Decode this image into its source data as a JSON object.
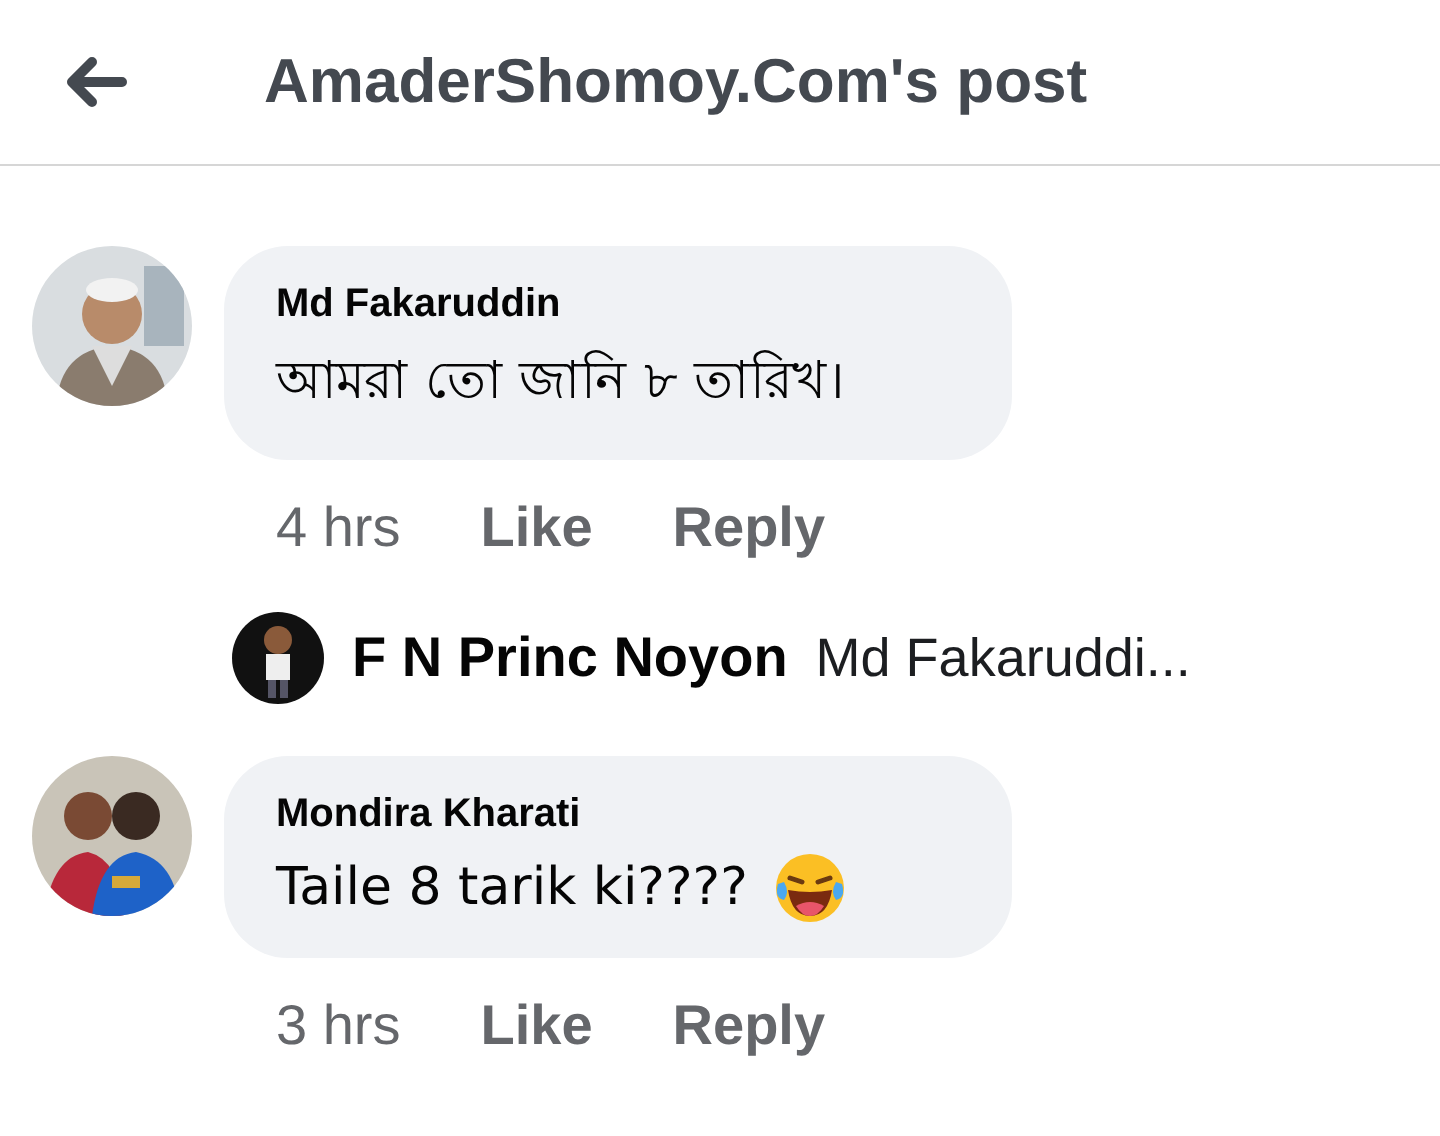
{
  "header": {
    "title": "AmaderShomoy.Com's post"
  },
  "comments": [
    {
      "author": "Md Fakaruddin",
      "text": "আমরা তো জানি ৮ তারিখ।",
      "trailing_icon": false,
      "time": "4 hrs",
      "actions": [
        "Like",
        "Reply"
      ],
      "reply_preview": {
        "author": "F N Princ Noyon",
        "text": "Md Fakaruddi..."
      }
    },
    {
      "author": "Mondira Kharati",
      "text": "Taile 8 tarik ki????",
      "trailing_icon": true,
      "time": "3 hrs",
      "actions": [
        "Like",
        "Reply"
      ]
    }
  ]
}
